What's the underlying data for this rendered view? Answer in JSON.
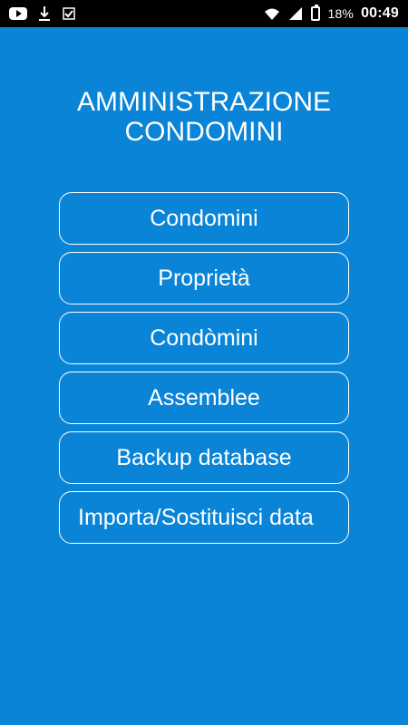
{
  "status_bar": {
    "battery_percent": "18%",
    "time": "00:49",
    "icons": [
      "youtube-icon",
      "download-icon",
      "check-badge-icon",
      "wifi-icon",
      "signal-icon",
      "battery-icon"
    ]
  },
  "screen": {
    "title": "AMMINISTRAZIONE\nCONDOMINI"
  },
  "menu": {
    "items": [
      {
        "label": "Condomini"
      },
      {
        "label": "Proprietà"
      },
      {
        "label": "Condòmini"
      },
      {
        "label": "Assemblee"
      },
      {
        "label": "Backup database"
      },
      {
        "label": "Importa/Sostituisci data"
      }
    ]
  },
  "colors": {
    "background": "#0a84d6",
    "status_bar": "#000000",
    "text": "#ffffff"
  }
}
